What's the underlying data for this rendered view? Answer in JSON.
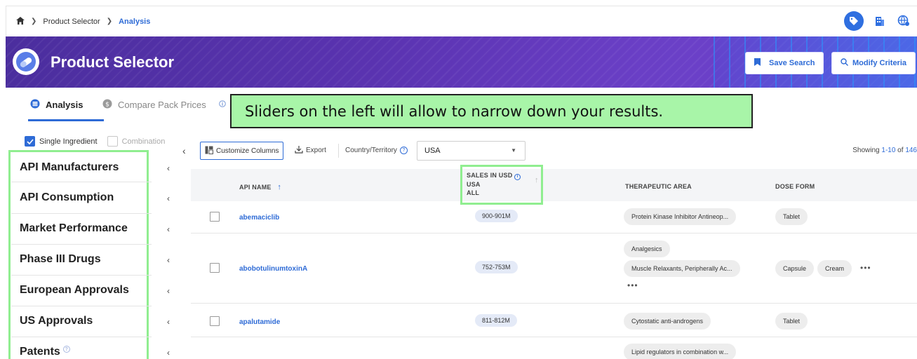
{
  "breadcrumb": {
    "items": [
      "Product Selector",
      "Analysis"
    ]
  },
  "header": {
    "title": "Product Selector",
    "save_search": "Save Search",
    "modify_criteria": "Modify Criteria"
  },
  "tabs": [
    {
      "label": "Analysis"
    },
    {
      "label": "Compare Pack Prices"
    }
  ],
  "callout": "Sliders on the left will allow to narrow down your results.",
  "ingredient": {
    "single": "Single Ingredient",
    "combination": "Combination"
  },
  "filters": [
    "API Manufacturers",
    "API Consumption",
    "Market Performance",
    "Phase III Drugs",
    "European Approvals",
    "US Approvals",
    "Patents"
  ],
  "toolbar": {
    "customize": "Customize Columns",
    "export": "Export",
    "country_label": "Country/Territory",
    "country_value": "USA",
    "showing_prefix": "Showing ",
    "showing_range": "1-10",
    "showing_of": " of ",
    "showing_total": "146"
  },
  "table": {
    "headers": {
      "api_name": "API NAME",
      "sales_line1": "SALES IN USD",
      "sales_line2": "USA",
      "sales_line3": "ALL",
      "therapeutic": "THERAPEUTIC AREA",
      "dose": "DOSE FORM"
    },
    "rows": [
      {
        "api": "abemaciclib",
        "sales": "900-901M",
        "areas": [
          "Protein Kinase Inhibitor Antineop..."
        ],
        "doses": [
          "Tablet"
        ]
      },
      {
        "api": "abobotulinumtoxinA",
        "sales": "752-753M",
        "areas": [
          "Analgesics",
          "Muscle Relaxants, Peripherally Ac..."
        ],
        "doses": [
          "Capsule",
          "Cream"
        ]
      },
      {
        "api": "apalutamide",
        "sales": "811-812M",
        "areas": [
          "Cytostatic anti-androgens"
        ],
        "doses": [
          "Tablet"
        ]
      },
      {
        "api": "",
        "sales": "",
        "areas": [
          "Lipid regulators in combination w..."
        ],
        "doses": []
      }
    ]
  },
  "colors": {
    "accent": "#2e6bd6",
    "banner": "#5a33b0",
    "highlight": "#90ee90",
    "callout_bg": "#a8f5a8"
  }
}
